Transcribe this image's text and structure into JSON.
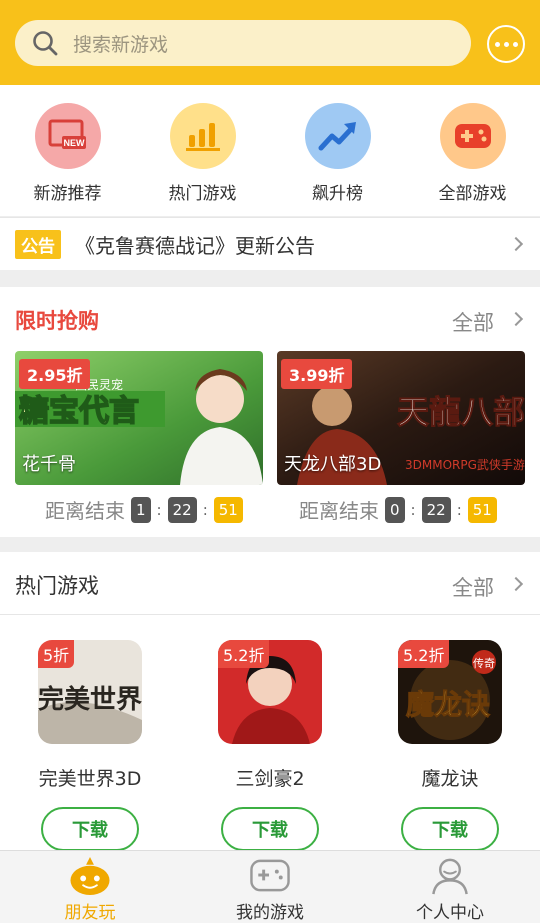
{
  "search": {
    "placeholder": "搜索新游戏",
    "icon": "search-icon"
  },
  "header": {
    "more_icon": "more-icon"
  },
  "categories": [
    {
      "label": "新游推荐",
      "icon": "new-games-icon",
      "color": "#f5a8a8"
    },
    {
      "label": "热门游戏",
      "icon": "bar-chart-icon",
      "color": "#ffe08a"
    },
    {
      "label": "飙升榜",
      "icon": "trend-up-icon",
      "color": "#9fc9f3"
    },
    {
      "label": "全部游戏",
      "icon": "gamepad-icon",
      "color": "#ffc88a"
    }
  ],
  "notice": {
    "tag": "公告",
    "text": "《克鲁赛德战记》更新公告"
  },
  "flash_sale": {
    "title": "限时抢购",
    "all_label": "全部",
    "items": [
      {
        "discount": "2.95折",
        "name": "花千骨",
        "countdown_label": "距离结束",
        "hours": "1",
        "minutes": "22",
        "seconds": "51",
        "banner_art_text": "糖宝代言",
        "banner_sub_text": "国民灵宠"
      },
      {
        "discount": "3.99折",
        "name": "天龙八部3D",
        "countdown_label": "距离结束",
        "hours": "0",
        "minutes": "22",
        "seconds": "51",
        "banner_art_text": "天龍八部",
        "banner_sub_text": "3DMMORPG武侠手游"
      }
    ]
  },
  "hot_games": {
    "title": "热门游戏",
    "all_label": "全部",
    "items": [
      {
        "discount": "5折",
        "name": "完美世界3D",
        "button": "下载",
        "art_text": "完美世界"
      },
      {
        "discount": "5.2折",
        "name": "三剑豪2",
        "button": "下载"
      },
      {
        "discount": "5.2折",
        "name": "魔龙诀",
        "button": "下载",
        "art_text": "魔龙诀",
        "art_badge": "传奇"
      }
    ]
  },
  "tabbar": [
    {
      "label": "朋友玩",
      "icon": "friends-play-icon",
      "active": true
    },
    {
      "label": "我的游戏",
      "icon": "gamepad-icon"
    },
    {
      "label": "个人中心",
      "icon": "user-icon"
    }
  ],
  "colors": {
    "brand": "#f8c11a",
    "sale_red": "#e8493e",
    "download_green": "#3cb043",
    "timer_dark": "#555555",
    "timer_yellow": "#f5b800"
  }
}
